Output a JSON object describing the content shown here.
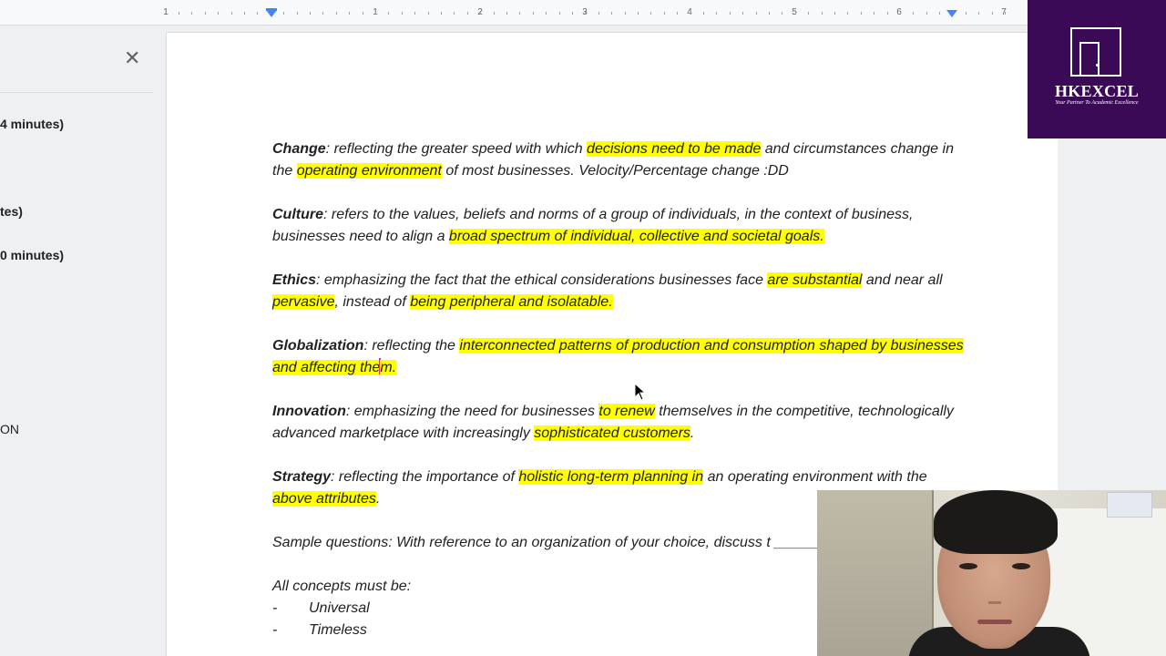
{
  "ruler": {
    "numbers": [
      "1",
      "1",
      "2",
      "3",
      "4",
      "5",
      "6",
      "7"
    ]
  },
  "outline": {
    "items": [
      "4 minutes)",
      "tes)",
      "0 minutes)",
      "ON"
    ]
  },
  "document": {
    "paragraphs": [
      {
        "segments": [
          {
            "text": "Change",
            "term": true
          },
          {
            "text": ": reflecting the greater speed with which "
          },
          {
            "text": "decisions need to be made",
            "highlight": true
          },
          {
            "text": " and circumstances change in the "
          },
          {
            "text": "operating environment",
            "highlight": true
          },
          {
            "text": " of most businesses. Velocity/Percentage change :DD"
          }
        ]
      },
      {
        "segments": [
          {
            "text": "Culture",
            "term": true
          },
          {
            "text": ": refers to the values, beliefs and norms of a group of individuals, in the context of business, businesses need to align a "
          },
          {
            "text": "broad spectrum of individual, collective and societal goals.",
            "highlight": true
          }
        ]
      },
      {
        "segments": [
          {
            "text": "Ethics",
            "term": true
          },
          {
            "text": ": emphasizing the fact that the ethical considerations businesses face "
          },
          {
            "text": "are substantial",
            "highlight": true
          },
          {
            "text": " and near all "
          },
          {
            "text": "pervasive",
            "highlight": true
          },
          {
            "text": ", instead of "
          },
          {
            "text": "being peripheral and isolatable.",
            "highlight": true
          }
        ]
      },
      {
        "segments": [
          {
            "text": "Globalization",
            "term": true
          },
          {
            "text": ": reflecting the "
          },
          {
            "text": "interconnected patterns of production and consumption shaped by businesses and affecting the",
            "highlight": true
          },
          {
            "caret": true
          },
          {
            "text": "m.",
            "highlight": true
          }
        ]
      },
      {
        "segments": [
          {
            "text": "Innovation",
            "term": true
          },
          {
            "text": ": emphasizing the need for businesses "
          },
          {
            "text": "to renew",
            "highlight": true
          },
          {
            "text": " themselves in the competitive, technologically advanced marketplace with increasingly "
          },
          {
            "text": "sophisticated customers",
            "highlight": true
          },
          {
            "text": "."
          }
        ]
      },
      {
        "segments": [
          {
            "text": "Strategy",
            "term": true
          },
          {
            "text": ": reflecting the importance of "
          },
          {
            "text": "holistic long-term planning in",
            "highlight": true
          },
          {
            "text": " an operating environment with the "
          },
          {
            "text": "above attributes",
            "highlight": true
          },
          {
            "text": "."
          }
        ]
      },
      {
        "segments": [
          {
            "text": "Sample questions: With reference to an organization of your choice, discuss t ______ on ______"
          }
        ]
      }
    ],
    "list_intro": "All concepts must be:",
    "list_items": [
      "Universal",
      "Timeless"
    ]
  },
  "logo": {
    "name": "HKEXCEL",
    "tagline": "Your Partner To Academic Excellence"
  },
  "colors": {
    "highlight": "#ffff00",
    "logo_bg": "#3b0a57",
    "ruler_marker": "#4285f4"
  },
  "icons": {
    "outline_close": "close-icon",
    "cursor": "mouse-pointer-icon",
    "logo_mark": "door-icon"
  }
}
